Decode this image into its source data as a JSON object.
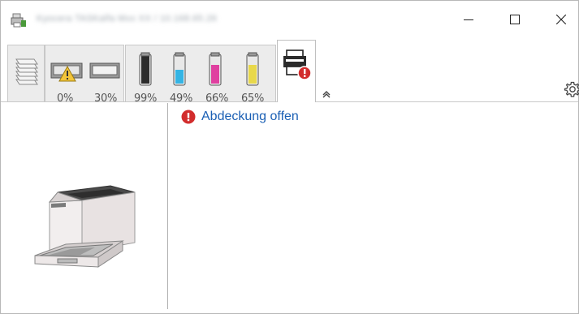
{
  "window": {
    "title": "Kyocera TASKalfa Mxx XX / 10.168.65.26"
  },
  "toolbar": {
    "tabs": [
      {
        "name": "Papier"
      },
      {
        "name": "Ausgabe"
      },
      {
        "name": "Toner"
      },
      {
        "name": "Status"
      }
    ],
    "tray_levels": [
      "0%",
      "30%"
    ],
    "toner_levels": [
      "99%",
      "49%",
      "66%",
      "65%"
    ],
    "toner_colors": {
      "black": "#2b2b2b",
      "cyan": "#34b4e4",
      "magenta": "#e040a0",
      "yellow": "#e8d84a"
    }
  },
  "status": {
    "message": "Abdeckung offen",
    "severity": "error",
    "error_color": "#d22c2c",
    "link_color": "#1a5fb4"
  }
}
